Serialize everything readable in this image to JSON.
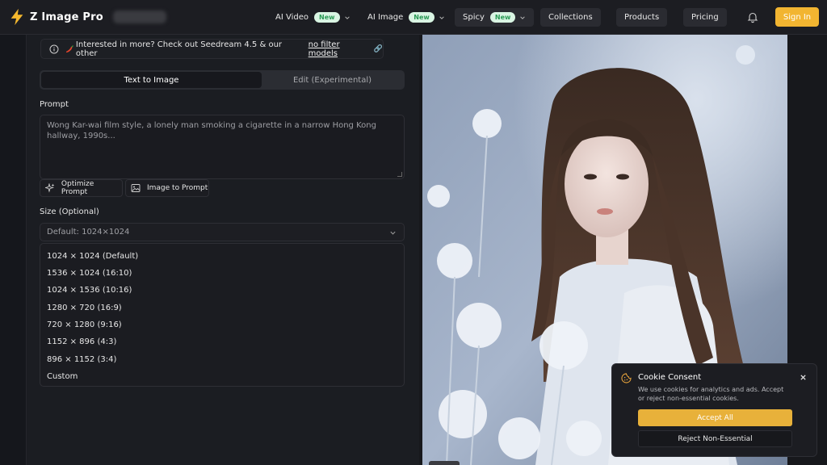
{
  "header": {
    "brand": "Z Image Pro",
    "nav": [
      {
        "label": "AI Video",
        "badge": "New"
      },
      {
        "label": "AI Image",
        "badge": "New"
      },
      {
        "label": "Spicy",
        "badge": "New"
      },
      {
        "label": "Collections"
      },
      {
        "label": "Products"
      },
      {
        "label": "Pricing"
      }
    ],
    "notifications_icon": "bell-icon",
    "sign_in": "Sign In"
  },
  "notice": {
    "text": "Interested in more? Check out Seedream 4.5 & our other",
    "link": "no filter models",
    "link_icon": "🔗"
  },
  "tabs": [
    {
      "label": "Text to Image",
      "active": true
    },
    {
      "label": "Edit (Experimental)",
      "active": false
    }
  ],
  "prompt": {
    "label": "Prompt",
    "placeholder": "Wong Kar-wai film style, a lonely man smoking a cigarette in a narrow Hong Kong hallway, 1990s...",
    "tools": [
      "Optimize Prompt",
      "Image to Prompt"
    ]
  },
  "size": {
    "label": "Size (Optional)",
    "selected": "Default: 1024×1024",
    "options": [
      "1024 × 1024 (Default)",
      "1536 × 1024 (16:10)",
      "1024 × 1536 (10:16)",
      "1280 × 720 (16:9)",
      "720 × 1280 (9:16)",
      "1152 × 896 (4:3)",
      "896 × 1152 (3:4)",
      "Custom"
    ]
  },
  "cookie": {
    "title": "Cookie Consent",
    "text": "We use cookies for analytics and ads. Accept or reject non-essential cookies.",
    "accept": "Accept All",
    "reject": "Reject Non-Essential"
  },
  "colors": {
    "accent": "#f2b531",
    "badge_bg": "#d9f5e3",
    "badge_text": "#2a9a55"
  }
}
